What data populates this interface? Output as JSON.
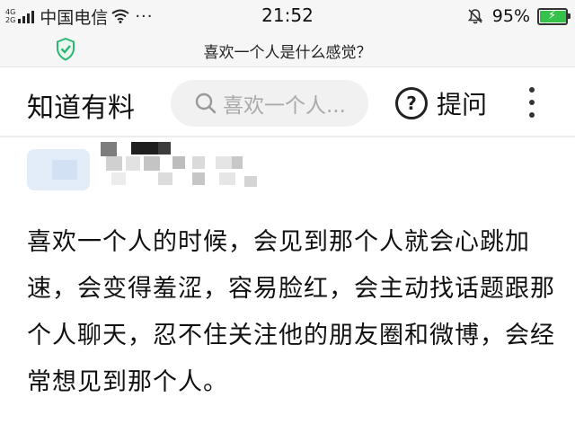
{
  "status_bar": {
    "network_top": "4G",
    "network_bottom": "2G",
    "carrier": "中国电信",
    "more_dots": "···",
    "time": "21:52",
    "battery_percent": "95%",
    "battery_level": 0.95,
    "icons": [
      "signal-icon",
      "wifi-icon",
      "mute-bell-icon",
      "battery-charging-icon"
    ]
  },
  "page": {
    "title": "喜欢一个人是什么感觉？",
    "security_icon": "shield-check-icon",
    "security_color": "#2bb673"
  },
  "app_bar": {
    "brand": "知道有料",
    "search_placeholder": "喜欢一个人...",
    "ask_icon": "question-circle-icon",
    "ask_label": "提问",
    "more_icon": "more-vertical-icon"
  },
  "answer": {
    "text": "喜欢一个人的时候，会见到那个人就会心跳加速，会变得羞涩，容易脸红，会主动找话题跟那个人聊天，忍不住关注他的朋友圈和微博，会经常想见到那个人。"
  },
  "colors": {
    "status_bg": "#f6f6f6",
    "battery_fill": "#35c24a",
    "search_bg": "#f1f1f1"
  }
}
